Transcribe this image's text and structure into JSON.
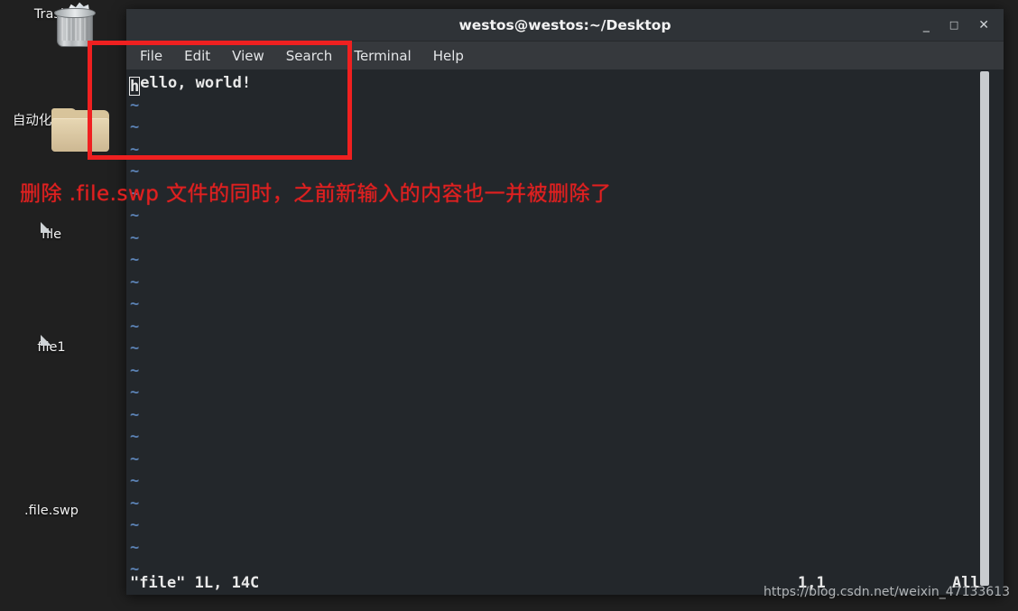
{
  "desktop": {
    "icons": [
      {
        "name": "Trash",
        "label": "Trash",
        "icon": "trash-icon"
      },
      {
        "name": "automation-ops",
        "label": "自动化运维...",
        "icon": "folder-icon"
      },
      {
        "name": "file",
        "label": "file",
        "icon": "document-icon"
      },
      {
        "name": "file1",
        "label": "file1",
        "icon": "document-icon"
      },
      {
        "name": "file-swp",
        "label": ".file.swp",
        "icon": "none"
      }
    ]
  },
  "terminal": {
    "title": "westos@westos:~/Desktop",
    "window_controls": {
      "minimize": "_",
      "maximize": "□",
      "close": "✕"
    },
    "menu": [
      "File",
      "Edit",
      "View",
      "Search",
      "Terminal",
      "Help"
    ],
    "editor": {
      "first_line_char": "h",
      "first_line_rest": "ello, world!",
      "tilde": "~",
      "tilde_rows": 22
    },
    "status": {
      "left": "\"file\" 1L, 14C",
      "position": "1,1",
      "scroll": "All"
    }
  },
  "annotation": {
    "text": "删除 .file.swp 文件的同时，之前新输入的内容也一并被删除了",
    "color": "#e02020",
    "highlight_box_color": "#ef2020"
  },
  "watermark": {
    "text": "https://blog.csdn.net/weixin_47133613"
  },
  "colors": {
    "desktop_bg": "#202020",
    "terminal_bg": "#23272b",
    "titlebar_bg": "#2f3337",
    "menubar_bg": "#36393d",
    "tilde_blue": "#5b82b4",
    "text_fg": "#e8e8e8",
    "scrollbar": "#c9cccf"
  }
}
